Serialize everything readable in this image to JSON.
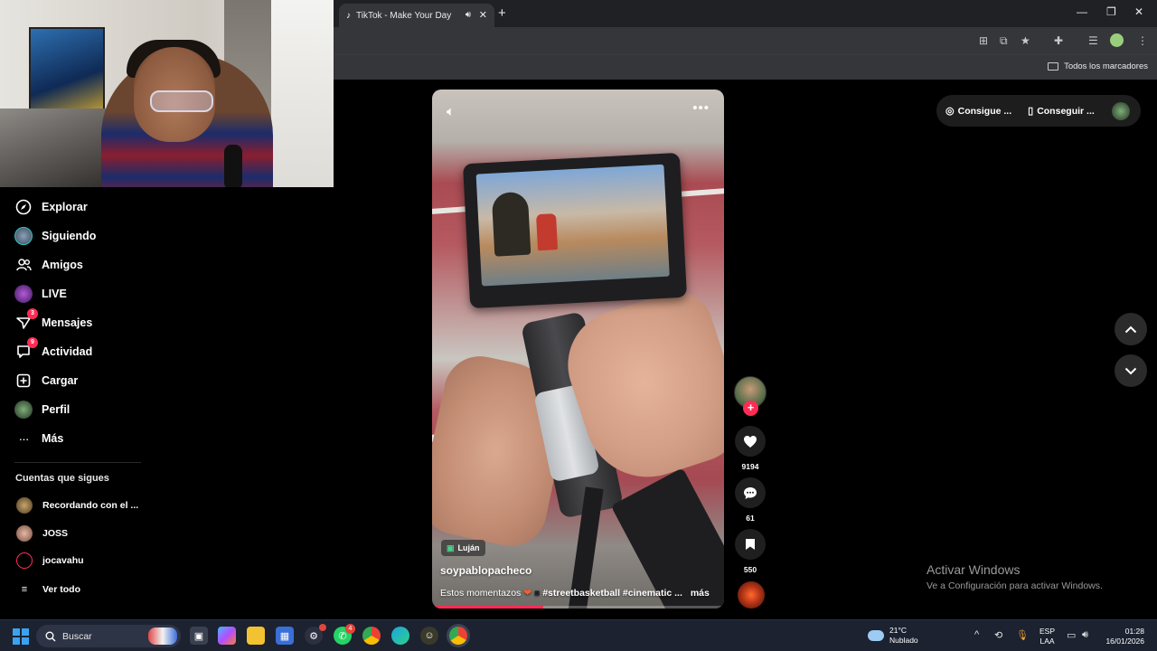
{
  "browser": {
    "tab_title": "TikTok - Make Your Day",
    "close_glyph": "✕",
    "new_tab_glyph": "+",
    "bookmarks_label": "Todos los marcadores",
    "icons": [
      "translate-icon",
      "cast-icon",
      "star-icon",
      "extensions-icon",
      "reading-list-icon",
      "profile-icon",
      "menu-icon"
    ]
  },
  "sidebar": {
    "items": [
      {
        "label": "Explorar",
        "icon": "compass-icon"
      },
      {
        "label": "Siguiendo",
        "icon": "avatar"
      },
      {
        "label": "Amigos",
        "icon": "friends-icon"
      },
      {
        "label": "LIVE",
        "icon": "live-avatar"
      },
      {
        "label": "Mensajes",
        "icon": "send-icon",
        "badge": "3"
      },
      {
        "label": "Actividad",
        "icon": "activity-icon",
        "badge": "9"
      },
      {
        "label": "Cargar",
        "icon": "upload-icon"
      },
      {
        "label": "Perfil",
        "icon": "profile-avatar"
      },
      {
        "label": "Más",
        "icon": "more-icon"
      }
    ],
    "following_title": "Cuentas que sigues",
    "following": [
      {
        "label": "Recordando con el ..."
      },
      {
        "label": "JOSS"
      },
      {
        "label": "jocavahu"
      }
    ],
    "see_all": "Ver todo"
  },
  "video": {
    "location": "Luján",
    "username": "soypablopacheco",
    "description_start": "Estos momentazos",
    "hashtags": "#streetbasketball #cinematic ...",
    "more_label": "más",
    "progress": 0.38
  },
  "actions": {
    "likes": "9194",
    "comments": "61",
    "saves": "550"
  },
  "topbar": {
    "btn1": "Consigue ...",
    "btn2": "Conseguir ..."
  },
  "watermark": {
    "title": "Activar Windows",
    "subtitle": "Ve a Configuración para activar Windows."
  },
  "taskbar": {
    "search_label": "Buscar",
    "whatsapp_badge": "4",
    "temperature": "21°C",
    "weather": "Nublado",
    "lang_top": "ESP",
    "lang_bottom": "LAA",
    "time": "01:28",
    "date": "16/01/2026"
  },
  "colors": {
    "accent": "#fe2c55",
    "browser_bg": "#202124",
    "taskbar_bg": "#1c2230"
  }
}
